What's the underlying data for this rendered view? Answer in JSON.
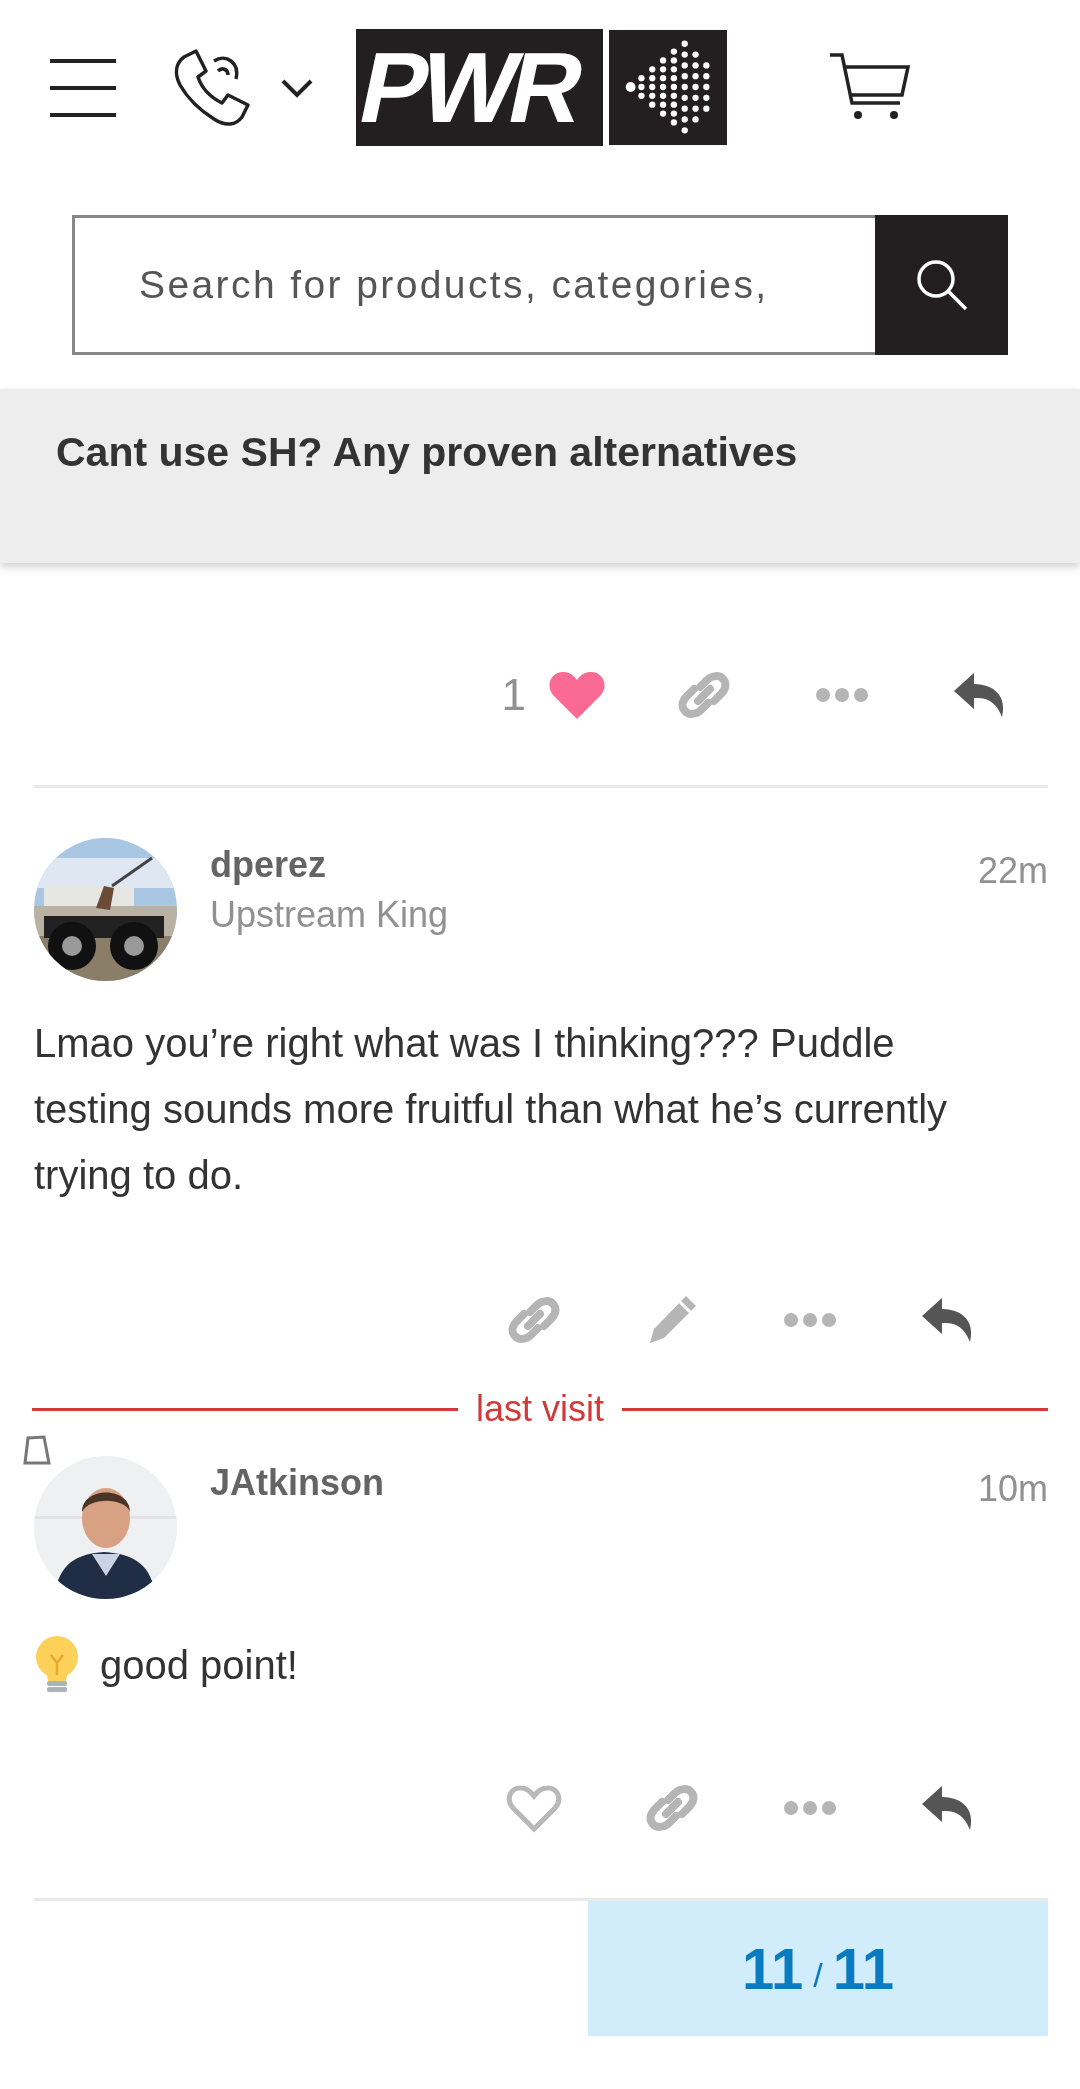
{
  "header": {
    "logo": "PWR",
    "search": {
      "placeholder": "Search for products, categories,"
    }
  },
  "topic": {
    "title": "Cant use SH? Any proven alternatives"
  },
  "posts": [
    {
      "kind": "partial",
      "actions": [
        {
          "kind": "like",
          "liked": true,
          "count": "1"
        },
        {
          "kind": "link"
        },
        {
          "kind": "more"
        },
        {
          "kind": "reply"
        }
      ]
    },
    {
      "kind": "full",
      "username": "dperez",
      "user_title": "Upstream King",
      "time": "22m",
      "body": "Lmao you’re right what was I thinking??? Puddle testing sounds more fruitful than what he’s currently trying to do.",
      "actions": [
        {
          "kind": "link"
        },
        {
          "kind": "edit"
        },
        {
          "kind": "more"
        },
        {
          "kind": "reply"
        }
      ]
    },
    {
      "kind": "last_visit",
      "label": "last visit"
    },
    {
      "kind": "full",
      "marked": true,
      "username": "JAtkinson",
      "time": "10m",
      "body": "good point!",
      "emoji": true,
      "actions": [
        {
          "kind": "like",
          "liked": false
        },
        {
          "kind": "link"
        },
        {
          "kind": "more"
        },
        {
          "kind": "reply"
        }
      ]
    }
  ],
  "progress": {
    "current": "11",
    "separator": "/",
    "total": "11"
  }
}
